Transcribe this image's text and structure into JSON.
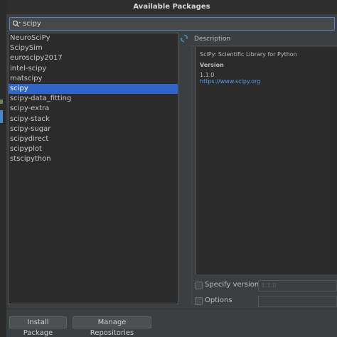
{
  "window": {
    "title": "Available Packages"
  },
  "search": {
    "value": "scipy"
  },
  "packages": [
    "NeuroSciPy",
    "ScipySim",
    "euroscipy2017",
    "intel-scipy",
    "matscipy",
    "scipy",
    "scipy-data_fitting",
    "scipy-extra",
    "scipy-stack",
    "scipy-sugar",
    "scipydirect",
    "scipyplot",
    "stscipython"
  ],
  "selected_index": 5,
  "description": {
    "label": "Description",
    "summary": "SciPy: Scientific Library for Python",
    "version_label": "Version",
    "version": "1.1.0",
    "link": "https://www.scipy.org"
  },
  "options": {
    "specify_version_label": "Specify version",
    "specify_version_value": "1.1.0",
    "options_label": "Options",
    "options_value": ""
  },
  "buttons": {
    "install": "Install Package",
    "manage": "Manage Repositories"
  },
  "colors": {
    "selection": "#2f65ca",
    "link": "#589df6",
    "focus_border": "#5a86c2"
  }
}
